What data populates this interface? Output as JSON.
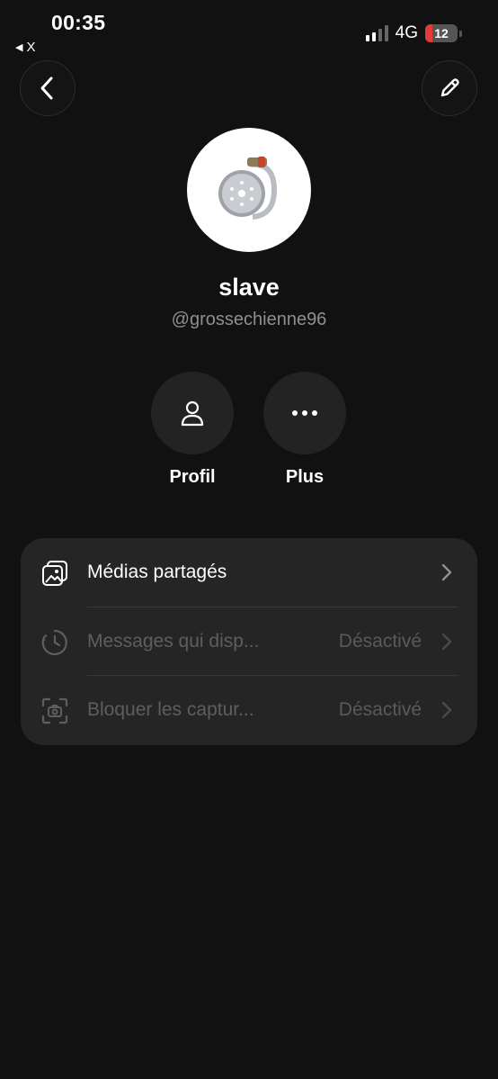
{
  "status_bar": {
    "time": "00:35",
    "back_app": "X",
    "network": "4G",
    "battery_level": "12",
    "battery_color": "#e23b3b"
  },
  "header": {
    "back_icon": "chevron-left-icon",
    "edit_icon": "pencil-icon"
  },
  "profile": {
    "name": "slave",
    "handle": "@grossechienne96"
  },
  "actions": [
    {
      "label": "Profil",
      "icon": "person-icon"
    },
    {
      "label": "Plus",
      "icon": "more-horizontal-icon"
    }
  ],
  "settings": [
    {
      "label": "Médias partagés",
      "value": "",
      "icon": "photos-icon",
      "enabled": true
    },
    {
      "label": "Messages qui disp...",
      "value": "Désactivé",
      "icon": "timer-icon",
      "enabled": false
    },
    {
      "label": "Bloquer les captur...",
      "value": "Désactivé",
      "icon": "screenshot-camera-icon",
      "enabled": false
    }
  ],
  "colors": {
    "background": "#111111",
    "card": "#252525",
    "secondary_text": "#8e8e93"
  }
}
